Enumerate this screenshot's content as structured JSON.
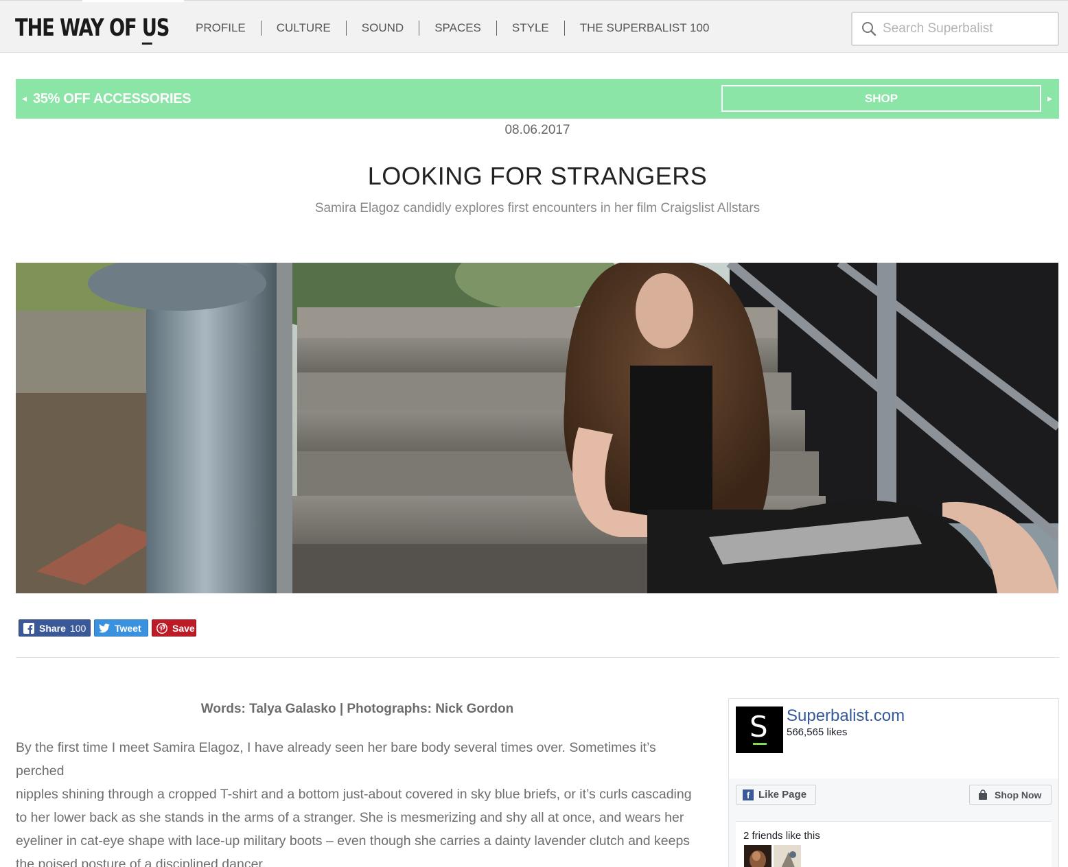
{
  "header": {
    "logo": "THE WAY OF US",
    "nav": [
      "PROFILE",
      "CULTURE",
      "SOUND",
      "SPACES",
      "STYLE",
      "THE SUPERBALIST 100"
    ],
    "search_placeholder": "Search Superbalist"
  },
  "promo": {
    "text": "35% OFF ACCESSORIES",
    "button": "SHOP",
    "color": "#8ae5a6"
  },
  "article": {
    "date": "08.06.2017",
    "title": "LOOKING FOR STRANGERS",
    "subtitle": "Samira Elagoz candidly explores first encounters in her film Craigslist Allstars",
    "credits": "Words: Talya Galasko | Photographs: Nick Gordon",
    "paragraph_lines": [
      "By the first time I meet Samira Elagoz, I have already seen her bare body several times over. Sometimes it’s perched",
      "nipples shining through a cropped T-shirt and a bottom just-about covered in sky blue briefs, or it’s curls cascading",
      "to her lower back as she stands in the arms of a stranger. She is mesmerizing and shy all at once, and wears her",
      "eyeliner in cat-eye shape with lace-up military boots – even though she carries a dainty lavender clutch and keeps",
      "the poised posture of a disciplined dancer."
    ]
  },
  "share": {
    "facebook_label": "Share",
    "facebook_count": "100",
    "twitter_label": "Tweet",
    "pinterest_label": "Save"
  },
  "facebook_widget": {
    "page_name": "Superbalist.com",
    "likes": "566,565 likes",
    "like_button": "Like Page",
    "shop_button": "Shop Now",
    "friends_text": "2 friends like this"
  }
}
